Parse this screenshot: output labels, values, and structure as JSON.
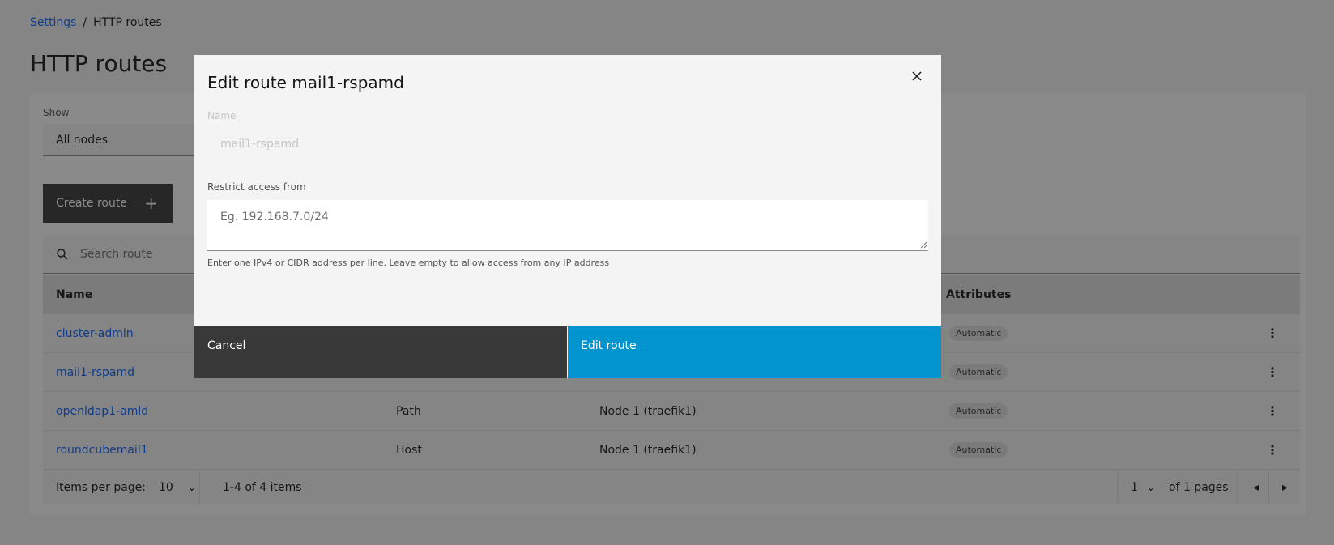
{
  "breadcrumb": {
    "settings": "Settings",
    "separator": "/",
    "current": "HTTP routes"
  },
  "page": {
    "title": "HTTP routes"
  },
  "filter": {
    "label": "Show",
    "value": "All nodes"
  },
  "toolbar": {
    "create_label": "Create route",
    "create_icon": "+"
  },
  "search": {
    "placeholder": "Search route"
  },
  "table": {
    "headers": {
      "name": "Name",
      "attributes": "Attributes"
    },
    "rows": [
      {
        "name": "cluster-admin",
        "type": "",
        "node": "",
        "attribute": "Automatic"
      },
      {
        "name": "mail1-rspamd",
        "type": "",
        "node": "",
        "attribute": "Automatic"
      },
      {
        "name": "openldap1-amld",
        "type": "Path",
        "node": "Node 1 (traefik1)",
        "attribute": "Automatic"
      },
      {
        "name": "roundcubemail1",
        "type": "Host",
        "node": "Node 1 (traefik1)",
        "attribute": "Automatic"
      }
    ],
    "overflow_glyph": "⋮"
  },
  "pagination": {
    "items_per_page_label": "Items per page:",
    "items_per_page": "10",
    "range": "1-4 of 4 items",
    "page": "1",
    "of_pages": "of 1 pages",
    "chevron": "⌄",
    "prev": "◂",
    "next": "▸"
  },
  "modal": {
    "title": "Edit route mail1-rspamd",
    "name_label": "Name",
    "name_value": "mail1-rspamd",
    "restrict_label": "Restrict access from",
    "restrict_placeholder": "Eg. 192.168.7.0/24",
    "helper": "Enter one IPv4 or CIDR address per line. Leave empty to allow access from any IP address",
    "cancel_label": "Cancel",
    "submit_label": "Edit route"
  },
  "colors": {
    "link": "#0f62fe",
    "primary": "#0294cf",
    "dark_button": "#393939"
  }
}
